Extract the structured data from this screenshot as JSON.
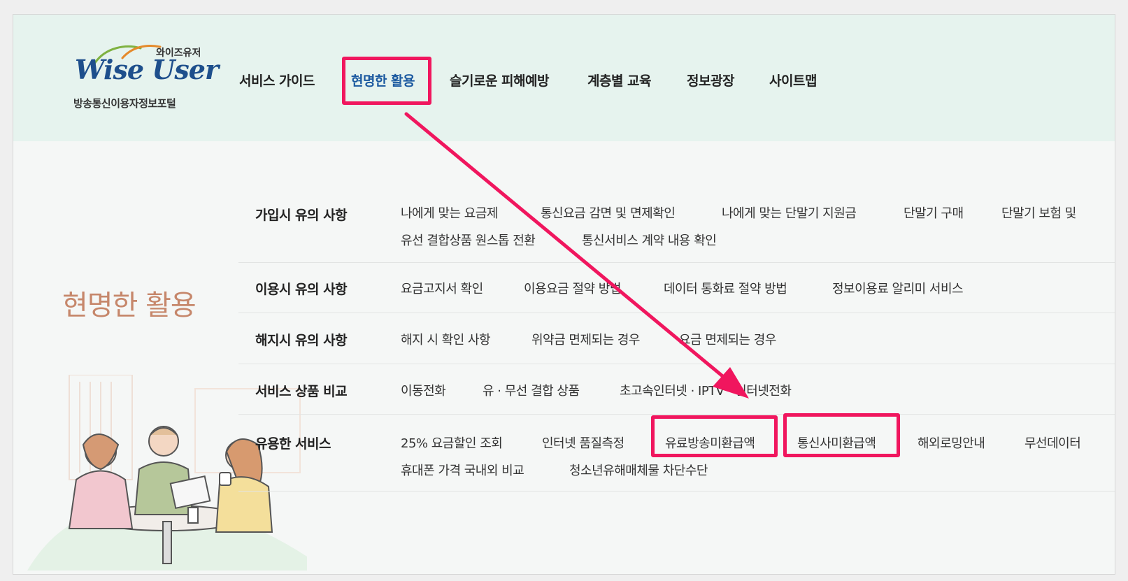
{
  "logo": {
    "small_ko": "와이즈유저",
    "brand": "Wise User",
    "sub_ko": "방송통신이용자정보포털"
  },
  "nav": [
    {
      "label": "서비스 가이드"
    },
    {
      "label": "현명한 활용",
      "active": true
    },
    {
      "label": "슬기로운 피해예방"
    },
    {
      "label": "계층별 교육"
    },
    {
      "label": "정보광장"
    },
    {
      "label": "사이트맵"
    }
  ],
  "section": {
    "title": "현명한 활용"
  },
  "menu": [
    {
      "label": "가입시 유의 사항",
      "links": [
        "나에게 맞는 요금제",
        "통신요금 감면 및 면제확인",
        "나에게 맞는 단말기 지원금",
        "단말기 구매",
        "단말기 보험 및",
        "유선 결합상품 원스톱 전환",
        "통신서비스 계약 내용 확인"
      ]
    },
    {
      "label": "이용시 유의 사항",
      "links": [
        "요금고지서 확인",
        "이용요금 절약 방법",
        "데이터 통화료 절약 방법",
        "정보이용료 알리미 서비스"
      ]
    },
    {
      "label": "해지시 유의 사항",
      "links": [
        "해지 시 확인 사항",
        "위약금 면제되는 경우",
        "요금 면제되는 경우"
      ]
    },
    {
      "label": "서비스 상품 비교",
      "links": [
        "이동전화",
        "유 · 무선 결합 상품",
        "초고속인터넷 · IPTV · 인터넷전화"
      ]
    },
    {
      "label": "유용한 서비스",
      "links": [
        "25% 요금할인 조회",
        "인터넷 품질측정",
        "유료방송미환급액",
        "통신사미환급액",
        "해외로밍안내",
        "무선데이터",
        "휴대폰 가격 국내외 비교",
        "청소년유해매체물 차단수단"
      ]
    }
  ],
  "annotation": {
    "highlight_color": "#f0165e"
  },
  "colors": {
    "header_bg": "#e6f3ee",
    "accent": "#1c5aa0",
    "section_title": "#c6876b"
  }
}
